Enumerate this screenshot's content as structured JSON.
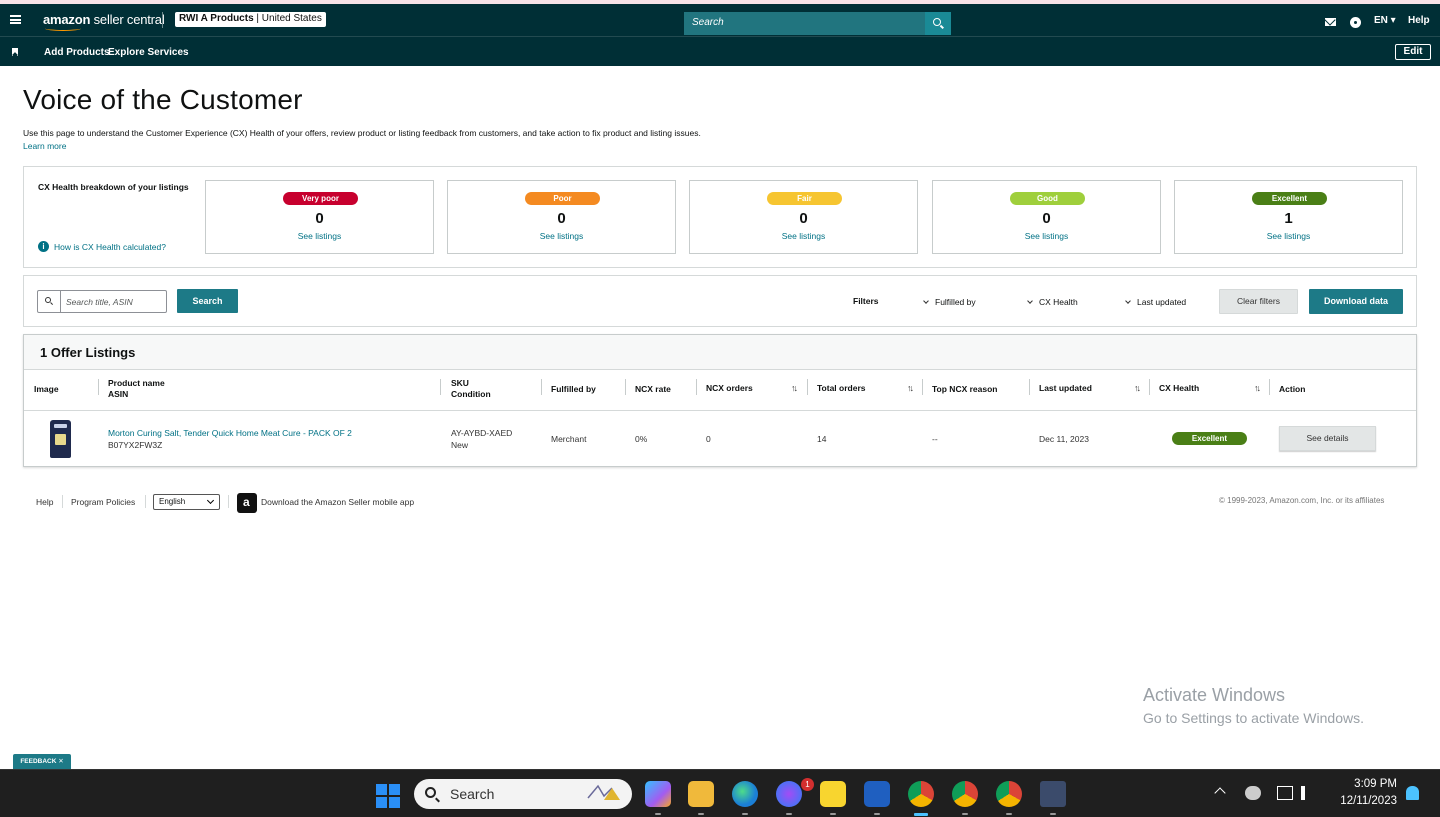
{
  "header": {
    "logo_main": "amazon",
    "logo_sub": " seller central",
    "account_store": "RWI A Products",
    "account_region": " | United States",
    "search_placeholder": "Search",
    "language": "EN ▾",
    "help": "Help"
  },
  "subnav": {
    "items": [
      "Add Products",
      "Explore Services"
    ],
    "edit": "Edit"
  },
  "page": {
    "title": "Voice of the Customer",
    "description": "Use this page to understand the Customer Experience (CX) Health of your offers, review product or listing feedback from customers, and take action to fix product and listing issues.",
    "learn_more": "Learn more"
  },
  "cx_health": {
    "title": "CX Health breakdown of your listings",
    "how_link": "How is CX Health calculated?",
    "cards": [
      {
        "label": "Very poor",
        "count": "0",
        "link": "See listings",
        "color": "#c7002e"
      },
      {
        "label": "Poor",
        "count": "0",
        "link": "See listings",
        "color": "#f48a21"
      },
      {
        "label": "Fair",
        "count": "0",
        "link": "See listings",
        "color": "#f6c531"
      },
      {
        "label": "Good",
        "count": "0",
        "link": "See listings",
        "color": "#9fcf3c"
      },
      {
        "label": "Excellent",
        "count": "1",
        "link": "See listings",
        "color": "#4a7f16"
      }
    ]
  },
  "filters": {
    "search_placeholder": "Search title, ASIN",
    "search_button": "Search",
    "label": "Filters",
    "dropdowns": [
      "Fulfilled by",
      "CX Health",
      "Last updated"
    ],
    "clear": "Clear filters",
    "download": "Download data"
  },
  "listings": {
    "title": "1 Offer Listings",
    "columns": {
      "image": "Image",
      "product_name": "Product name",
      "asin": "ASIN",
      "sku": "SKU",
      "condition": "Condition",
      "fulfilled_by": "Fulfilled by",
      "ncx_rate": "NCX rate",
      "ncx_orders": "NCX orders",
      "total_orders": "Total orders",
      "top_reason": "Top NCX reason",
      "last_updated": "Last updated",
      "cx_health": "CX Health",
      "action": "Action"
    },
    "rows": [
      {
        "product_name": "Morton Curing Salt, Tender Quick Home Meat Cure - PACK OF 2",
        "asin": "B07YX2FW3Z",
        "sku": "AY-AYBD-XAED",
        "condition": "New",
        "fulfilled_by": "Merchant",
        "ncx_rate": "0%",
        "ncx_orders": "0",
        "total_orders": "14",
        "top_reason": "--",
        "last_updated": "Dec 11, 2023",
        "cx_health": "Excellent",
        "action": "See details"
      }
    ]
  },
  "footer": {
    "links": [
      "Help",
      "Program Policies"
    ],
    "language": "English",
    "app_text": "Download the Amazon Seller mobile app",
    "copyright": "© 1999-2023, Amazon.com, Inc. or its affiliates"
  },
  "watermark": {
    "line1": "Activate Windows",
    "line2": "Go to Settings to activate Windows."
  },
  "feedback": "FEEDBACK ✕",
  "taskbar": {
    "search": "Search",
    "messenger_badge": "1",
    "time": "3:09 PM",
    "date": "12/11/2023"
  }
}
